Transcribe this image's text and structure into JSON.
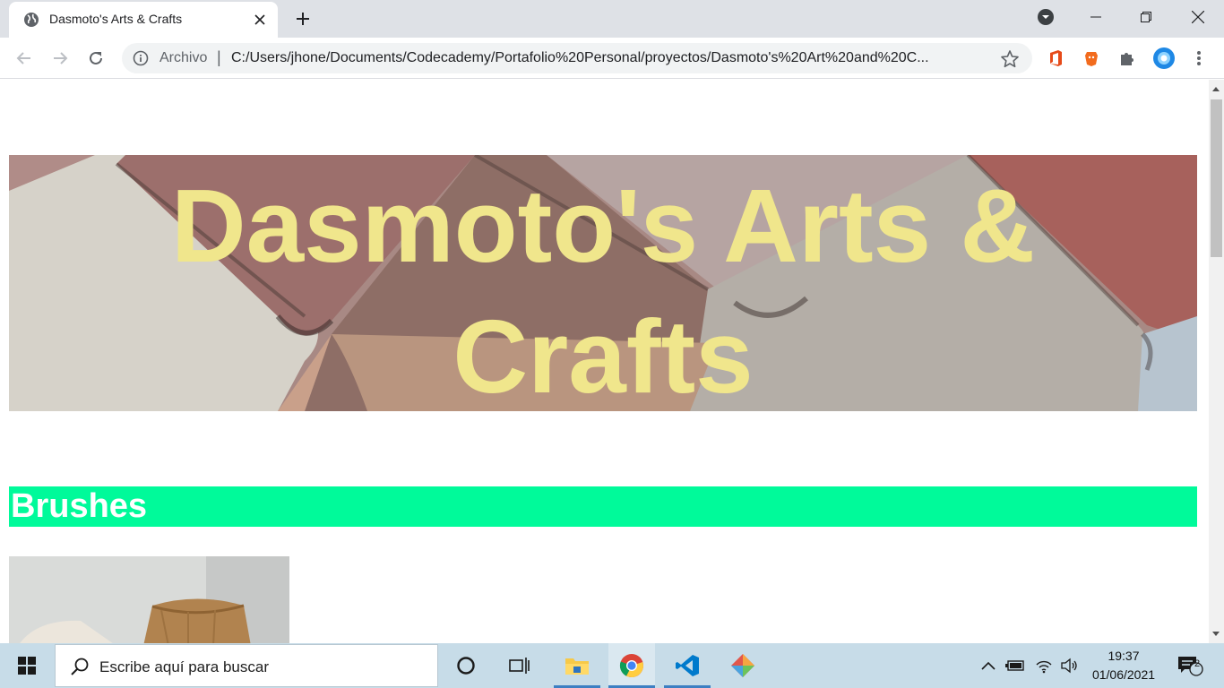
{
  "browser": {
    "tab": {
      "title": "Dasmoto's Arts & Crafts"
    },
    "omnibox": {
      "scheme_label": "Archivo",
      "separator": "|",
      "url": "C:/Users/jhone/Documents/Codecademy/Portafolio%20Personal/proyectos/Dasmoto's%20Art%20and%20C..."
    },
    "extensions": [
      "office-icon",
      "brave-lion-icon",
      "puzzle-extensions-icon",
      "profile-avatar"
    ]
  },
  "page": {
    "hero_title": "Dasmoto's Arts & Crafts",
    "section_heading": "Brushes",
    "colors": {
      "hero_text": "#f0e68c",
      "section_bg": "#00fa9a",
      "section_text": "#ffffff"
    }
  },
  "taskbar": {
    "search_placeholder": "Escribe aquí para buscar",
    "apps": [
      "cortana-icon",
      "task-view-icon",
      "file-explorer-icon",
      "chrome-icon",
      "vscode-icon",
      "git-icon"
    ],
    "clock": {
      "time": "19:37",
      "date": "01/06/2021"
    },
    "notifications_count": "2"
  }
}
